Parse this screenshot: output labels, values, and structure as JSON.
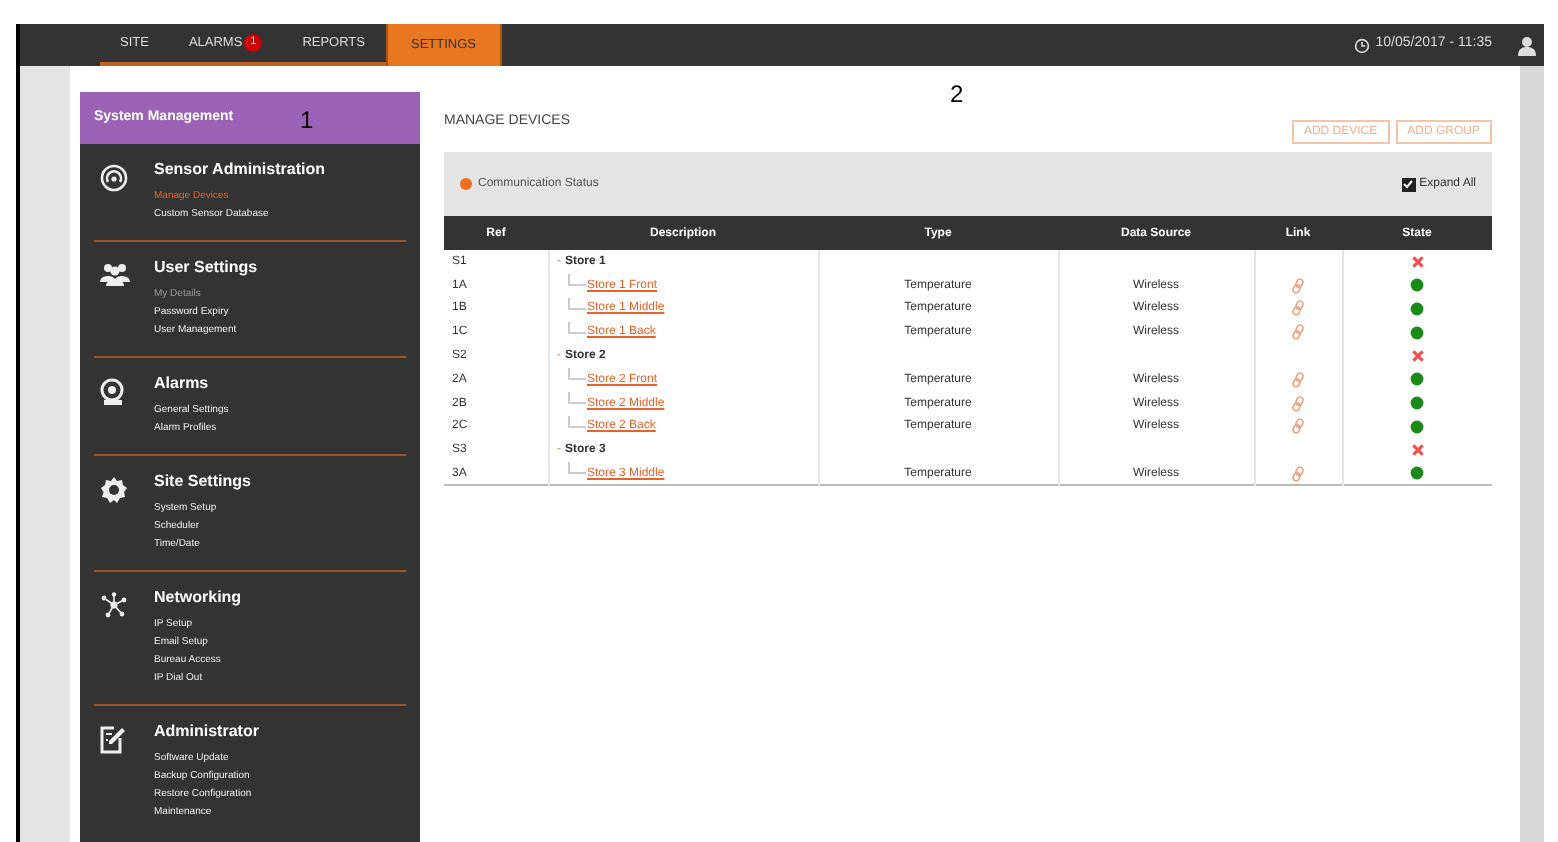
{
  "nav": {
    "tabs": [
      {
        "label": "SITE",
        "selected": false
      },
      {
        "label": "ALARMS",
        "badge": "1",
        "selected": false
      },
      {
        "label": "REPORTS",
        "selected": false
      },
      {
        "label": "SETTINGS",
        "selected": true
      }
    ],
    "datetime": "10/05/2017 - 11:35"
  },
  "sidebar": {
    "title": "System Management",
    "annotation": "1",
    "sections": [
      {
        "title": "Sensor Administration",
        "items": [
          {
            "label": "Manage Devices",
            "selected": true,
            "disabled": false
          },
          {
            "label": "Custom Sensor Database",
            "selected": false,
            "disabled": false
          }
        ]
      },
      {
        "title": "User Settings",
        "items": [
          {
            "label": "My Details",
            "selected": false,
            "disabled": true
          },
          {
            "label": "Password Expiry",
            "selected": false,
            "disabled": false
          },
          {
            "label": "User Management",
            "selected": false,
            "disabled": false
          }
        ]
      },
      {
        "title": "Alarms",
        "items": [
          {
            "label": "General Settings",
            "selected": false,
            "disabled": false
          },
          {
            "label": "Alarm Profiles",
            "selected": false,
            "disabled": false
          }
        ]
      },
      {
        "title": "Site Settings",
        "items": [
          {
            "label": "System Setup",
            "selected": false,
            "disabled": false
          },
          {
            "label": "Scheduler",
            "selected": false,
            "disabled": false
          },
          {
            "label": "Time/Date",
            "selected": false,
            "disabled": false
          }
        ]
      },
      {
        "title": "Networking",
        "items": [
          {
            "label": "IP Setup",
            "selected": false,
            "disabled": false
          },
          {
            "label": "Email Setup",
            "selected": false,
            "disabled": false
          },
          {
            "label": "Bureau Access",
            "selected": false,
            "disabled": false
          },
          {
            "label": "IP Dial Out",
            "selected": false,
            "disabled": false
          }
        ]
      },
      {
        "title": "Administrator",
        "items": [
          {
            "label": "Software Update",
            "selected": false,
            "disabled": false
          },
          {
            "label": "Backup Configuration",
            "selected": false,
            "disabled": false
          },
          {
            "label": "Restore Configuration",
            "selected": false,
            "disabled": false
          },
          {
            "label": "Maintenance",
            "selected": false,
            "disabled": false
          }
        ]
      }
    ]
  },
  "main": {
    "title": "MANAGE DEVICES",
    "annotation": "2",
    "buttons": [
      "ADD DEVICE",
      "ADD GROUP"
    ],
    "legend": {
      "label": "Communication Status",
      "color": "#f07020"
    },
    "expand_all": {
      "label": "Expand All",
      "checked": true
    },
    "table": {
      "columns": [
        "Ref",
        "Description",
        "Type",
        "Data Source",
        "Link",
        "State"
      ],
      "rows": [
        {
          "kind": "group",
          "ref": "S1",
          "description": "Store 1",
          "toggle": "-",
          "online": false
        },
        {
          "kind": "device",
          "ref": "1A",
          "description": "Store 1 Front",
          "type": "Temperature",
          "source": "Wireless",
          "online": true
        },
        {
          "kind": "device",
          "ref": "1B",
          "description": "Store 1 Middle",
          "type": "Temperature",
          "source": "Wireless",
          "online": true
        },
        {
          "kind": "device",
          "ref": "1C",
          "description": "Store 1 Back",
          "type": "Temperature",
          "source": "Wireless",
          "online": true
        },
        {
          "kind": "group",
          "ref": "S2",
          "description": "Store 2",
          "toggle": "-",
          "online": false
        },
        {
          "kind": "device",
          "ref": "2A",
          "description": "Store 2 Front",
          "type": "Temperature",
          "source": "Wireless",
          "online": true
        },
        {
          "kind": "device",
          "ref": "2B",
          "description": "Store 2 Middle",
          "type": "Temperature",
          "source": "Wireless",
          "online": true
        },
        {
          "kind": "device",
          "ref": "2C",
          "description": "Store 2 Back",
          "type": "Temperature",
          "source": "Wireless",
          "online": true
        },
        {
          "kind": "group",
          "ref": "S3",
          "description": "Store 3",
          "toggle": "-",
          "online": false
        },
        {
          "kind": "device",
          "ref": "3A",
          "description": "Store 3 Middle",
          "type": "Temperature",
          "source": "Wireless",
          "online": true
        }
      ]
    }
  }
}
